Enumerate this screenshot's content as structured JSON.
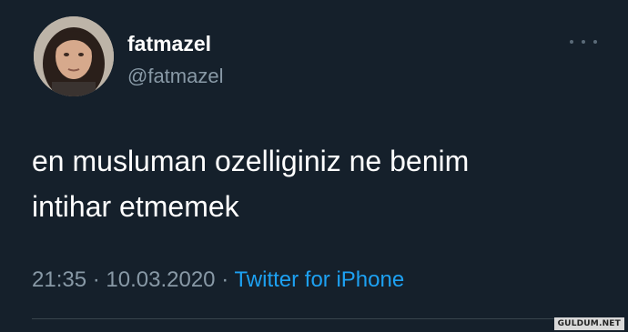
{
  "tweet": {
    "display_name": "fatmazel",
    "handle": "@fatmazel",
    "text_lines": [
      "en musluman ozelliginiz ne benim",
      "intihar etmemek"
    ],
    "time": "21:35",
    "separator": "·",
    "date": "10.03.2020",
    "source": "Twitter for iPhone"
  },
  "icons": {
    "more": "more-options-icon",
    "avatar": "profile-photo"
  },
  "watermark": "GULDUM.NET",
  "colors": {
    "background": "#15202b",
    "primary_text": "#ffffff",
    "secondary_text": "#8899a6",
    "link": "#1da1f2"
  }
}
